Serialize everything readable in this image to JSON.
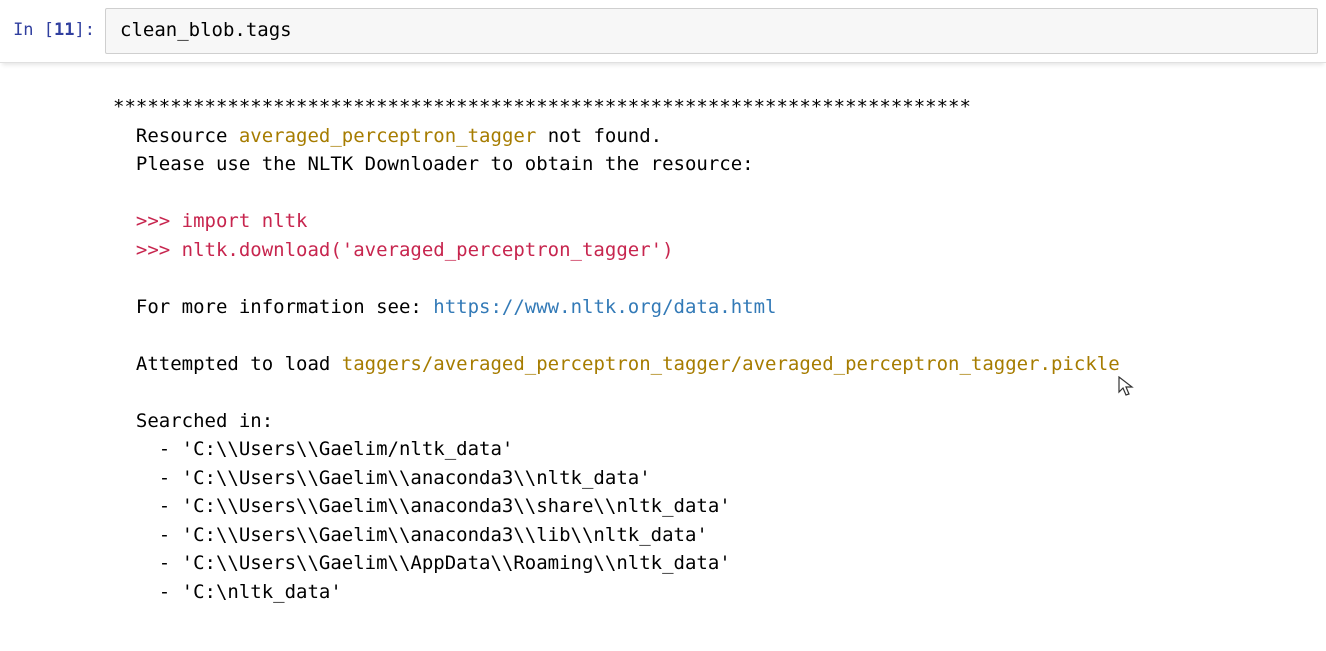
{
  "cell": {
    "prompt_in": "In ",
    "prompt_open": "[",
    "prompt_number": "11",
    "prompt_close": "]:",
    "code": "clean_blob.tags"
  },
  "output": {
    "separator": "***************************************************************************",
    "resource_prefix": "  Resource ",
    "resource_name": "averaged_perceptron_tagger",
    "resource_suffix": " not found.",
    "please_use": "  Please use the NLTK Downloader to obtain the resource:",
    "code1": "  >>> import nltk",
    "code2": "  >>> nltk.download('averaged_perceptron_tagger')",
    "more_info_prefix": "  For more information see: ",
    "more_info_url": "https://www.nltk.org/data.html",
    "attempted_prefix": "  Attempted to load ",
    "attempted_path": "taggers/averaged_perceptron_tagger/averaged_perceptron_tagger.pickle",
    "searched_in": "  Searched in:",
    "path1": "    - 'C:\\\\Users\\\\Gaelim/nltk_data'",
    "path2": "    - 'C:\\\\Users\\\\Gaelim\\\\anaconda3\\\\nltk_data'",
    "path3": "    - 'C:\\\\Users\\\\Gaelim\\\\anaconda3\\\\share\\\\nltk_data'",
    "path4": "    - 'C:\\\\Users\\\\Gaelim\\\\anaconda3\\\\lib\\\\nltk_data'",
    "path5": "    - 'C:\\\\Users\\\\Gaelim\\\\AppData\\\\Roaming\\\\nltk_data'",
    "path6": "    - 'C:\\nltk_data'"
  }
}
